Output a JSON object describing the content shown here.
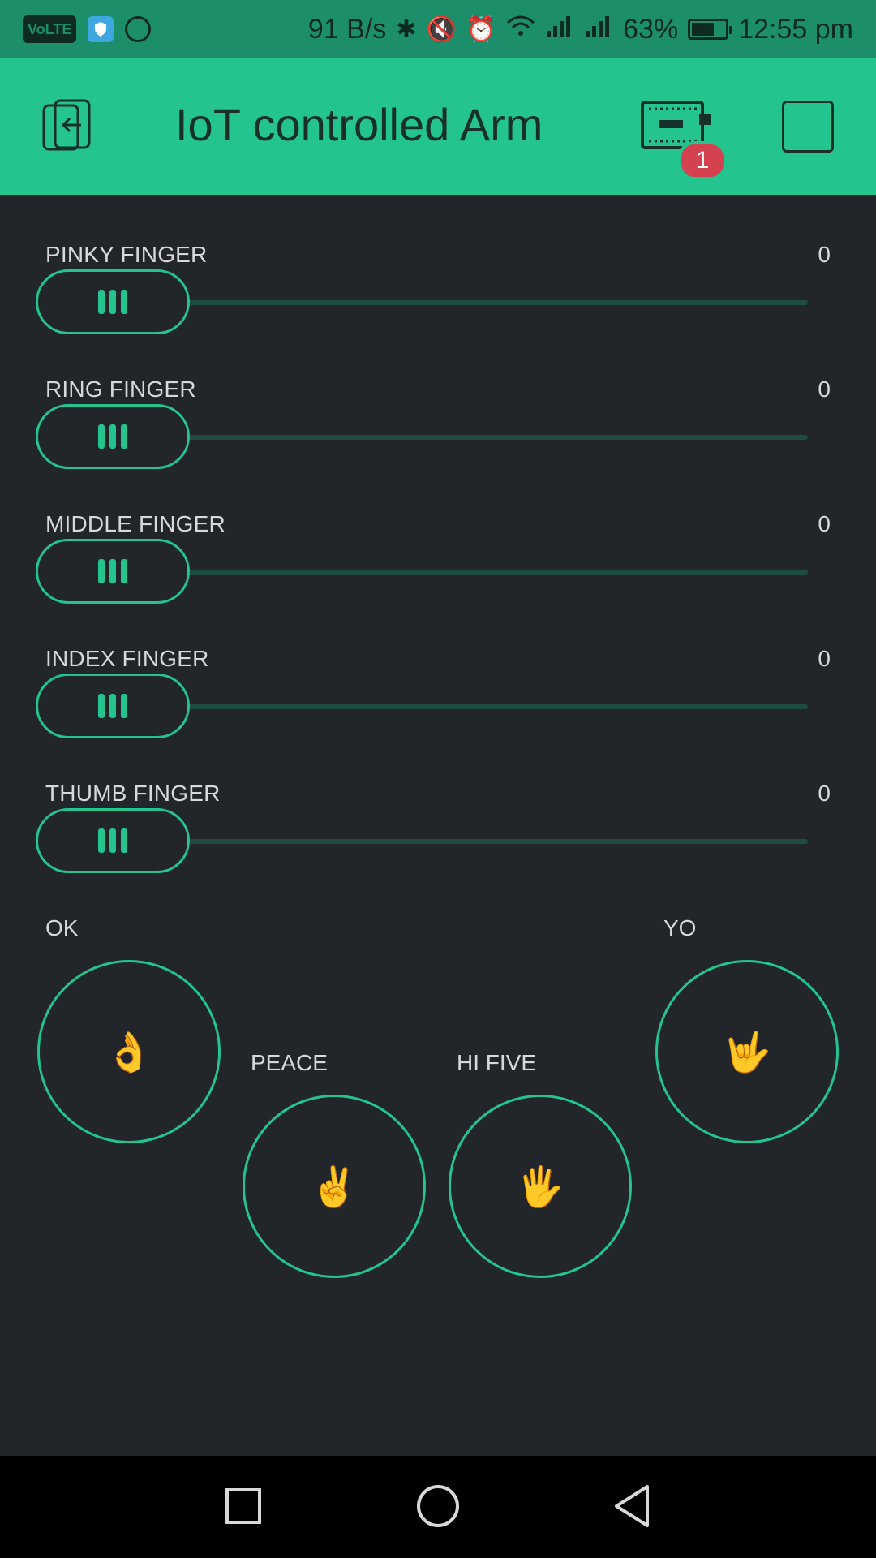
{
  "status_bar": {
    "volte": "VoLTE",
    "speed": "91 B/s",
    "battery_percent": "63%",
    "time": "12:55 pm",
    "icons": [
      "shield-icon",
      "whatsapp-icon",
      "bluetooth-icon",
      "mute-icon",
      "alarm-icon",
      "wifi-icon",
      "signal-icon"
    ]
  },
  "app_bar": {
    "title": "IoT controlled Arm",
    "device_badge": "1",
    "accent": "#23C48E"
  },
  "sliders": [
    {
      "label": "PINKY FINGER",
      "value": "0",
      "fraction": 0
    },
    {
      "label": "RING FINGER",
      "value": "0",
      "fraction": 0
    },
    {
      "label": "MIDDLE FINGER",
      "value": "0",
      "fraction": 0
    },
    {
      "label": "INDEX FINGER",
      "value": "0",
      "fraction": 0
    },
    {
      "label": "THUMB FINGER",
      "value": "0",
      "fraction": 0
    }
  ],
  "gestures": {
    "ok": {
      "label": "OK",
      "icon": "👌"
    },
    "peace": {
      "label": "PEACE",
      "icon": "✌"
    },
    "hi_five": {
      "label": "HI FIVE",
      "icon": "🖐"
    },
    "yo": {
      "label": "YO",
      "icon": "🤟"
    }
  }
}
